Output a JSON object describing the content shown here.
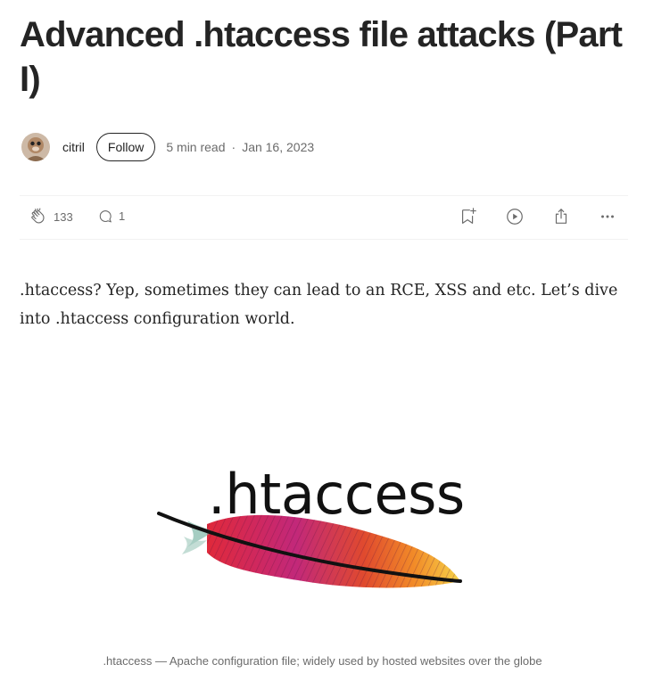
{
  "article": {
    "title": "Advanced .htaccess file attacks (Part I)",
    "author": "citril",
    "follow_label": "Follow",
    "read_time": "5 min read",
    "separator": "·",
    "date": "Jan 16, 2023"
  },
  "actions": {
    "claps": "133",
    "comments": "1"
  },
  "icons": {
    "clap": "clap-icon",
    "comment": "comment-icon",
    "bookmark": "bookmark-add-icon",
    "listen": "play-icon",
    "share": "share-icon",
    "more": "more-icon"
  },
  "content": {
    "intro": ".htaccess? Yep, sometimes they can lead to an RCE, XSS and etc. Let’s dive into .htaccess configuration world."
  },
  "figure": {
    "word": ".htaccess",
    "caption": ".htaccess — Apache configuration file; widely used by hosted websites over the globe",
    "colors": {
      "feather_dark": "#8b1a6b",
      "feather_red": "#e0293a",
      "feather_orange": "#f28c28",
      "feather_yellow": "#f6d34a"
    }
  }
}
